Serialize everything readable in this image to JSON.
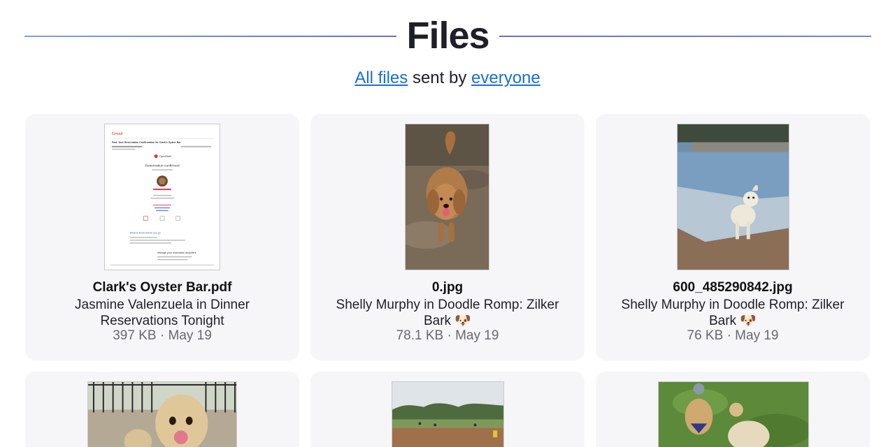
{
  "header": {
    "title": "Files",
    "all_files_link": "All files",
    "sent_by_text": "sent by",
    "everyone_link": "everyone"
  },
  "files": [
    {
      "name": "Clark's Oyster Bar.pdf",
      "description": "Jasmine Valenzuela in Dinner Reservations Tonight",
      "size": "397 KB",
      "date": "May 19",
      "separator": "·",
      "thumbnail": "email-document-preview",
      "preview": {
        "app": "Gmail",
        "subject": "Fwd: Your Reservation Confirmation for Clark's Oyster Bar",
        "brand": "OpenTable",
        "heading": "Reservation confirmed",
        "section": "What to know before you go",
        "manage": "Manage your reservation anywhere"
      }
    },
    {
      "name": "0.jpg",
      "description": "Shelly Murphy in Doodle Romp: Zilker Bark 🐶",
      "size": "78.1 KB",
      "date": "May 19",
      "separator": "·",
      "thumbnail": "dog-photo"
    },
    {
      "name": "600_485290842.jpg",
      "description": "Shelly Murphy in Doodle Romp: Zilker Bark 🐶",
      "size": "76 KB",
      "date": "May 19",
      "separator": "·",
      "thumbnail": "dog-in-water-photo"
    },
    {
      "thumbnail": "dogs-by-fence-photo"
    },
    {
      "thumbnail": "park-photo"
    },
    {
      "thumbnail": "dogs-on-grass-photo"
    }
  ],
  "colors": {
    "link": "#1a6fd1",
    "card_bg": "#f6f6f8",
    "meta_text": "#666a70"
  }
}
